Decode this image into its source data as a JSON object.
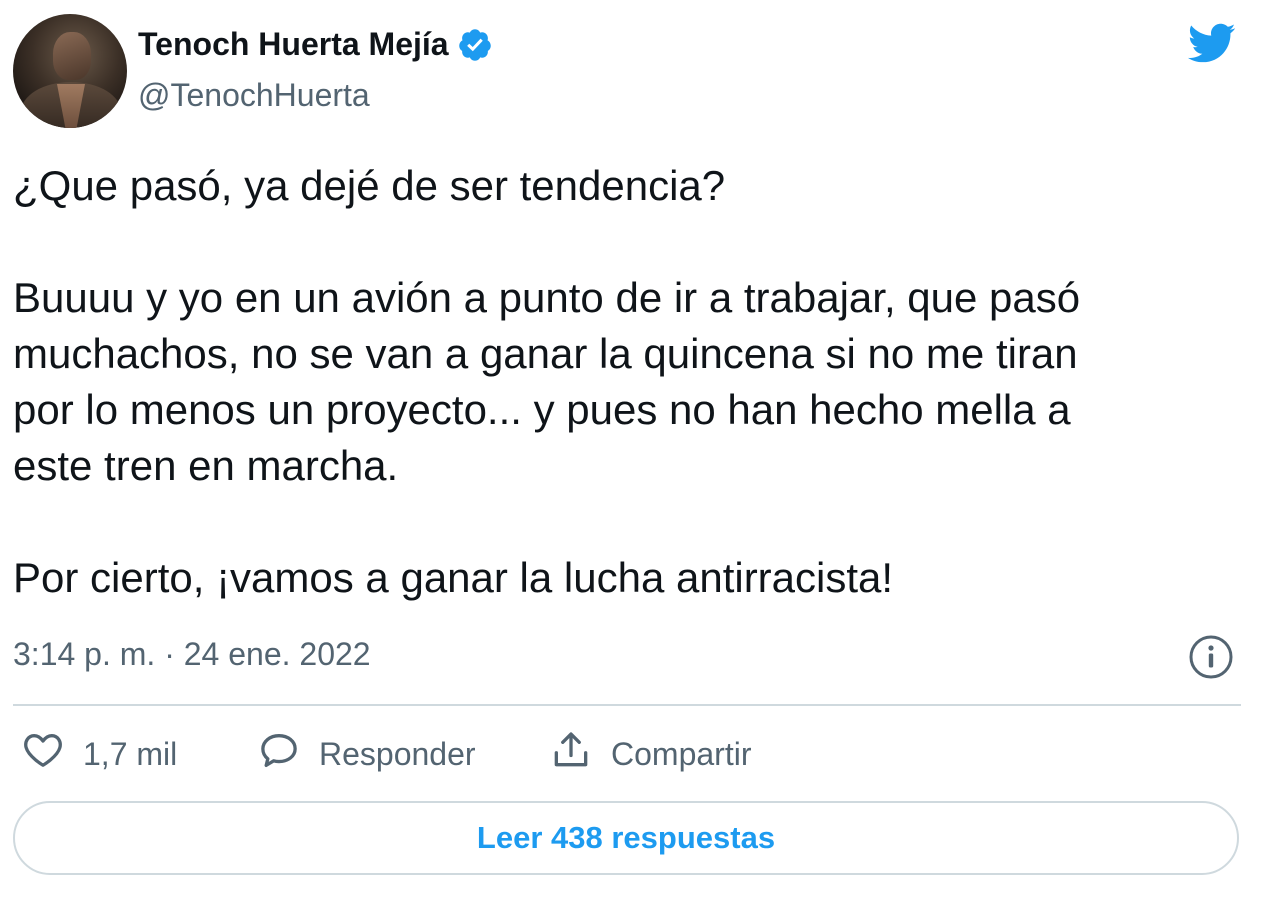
{
  "author": {
    "display_name": "Tenoch Huerta Mejía",
    "handle": "@TenochHuerta",
    "verified": true
  },
  "tweet": {
    "lines_block1": [
      "¿Que pasó, ya dejé de ser tendencia?"
    ],
    "lines_block2": [
      "Buuuu y yo en un avión a punto de ir a trabajar, que pasó",
      "muchachos, no se van a ganar la quincena si no me tiran",
      "por lo menos un proyecto... y pues no han hecho mella a",
      "este tren en marcha."
    ],
    "lines_block3": [
      "Por cierto, ¡vamos a ganar la lucha antirracista!"
    ],
    "timestamp": "3:14 p. m. · 24 ene. 2022"
  },
  "actions": {
    "like_count": "1,7 mil",
    "reply_label": "Responder",
    "share_label": "Compartir"
  },
  "read_replies_label": "Leer 438 respuestas",
  "icons": {
    "brand": "twitter-bird-icon",
    "verified": "verified-badge-icon",
    "info": "info-icon",
    "like": "heart-icon",
    "reply": "speech-bubble-icon",
    "share": "share-upload-icon"
  },
  "colors": {
    "accent": "#1d9bf0",
    "text": "#0f1419",
    "secondary": "#536471",
    "border": "#cfd9de"
  }
}
